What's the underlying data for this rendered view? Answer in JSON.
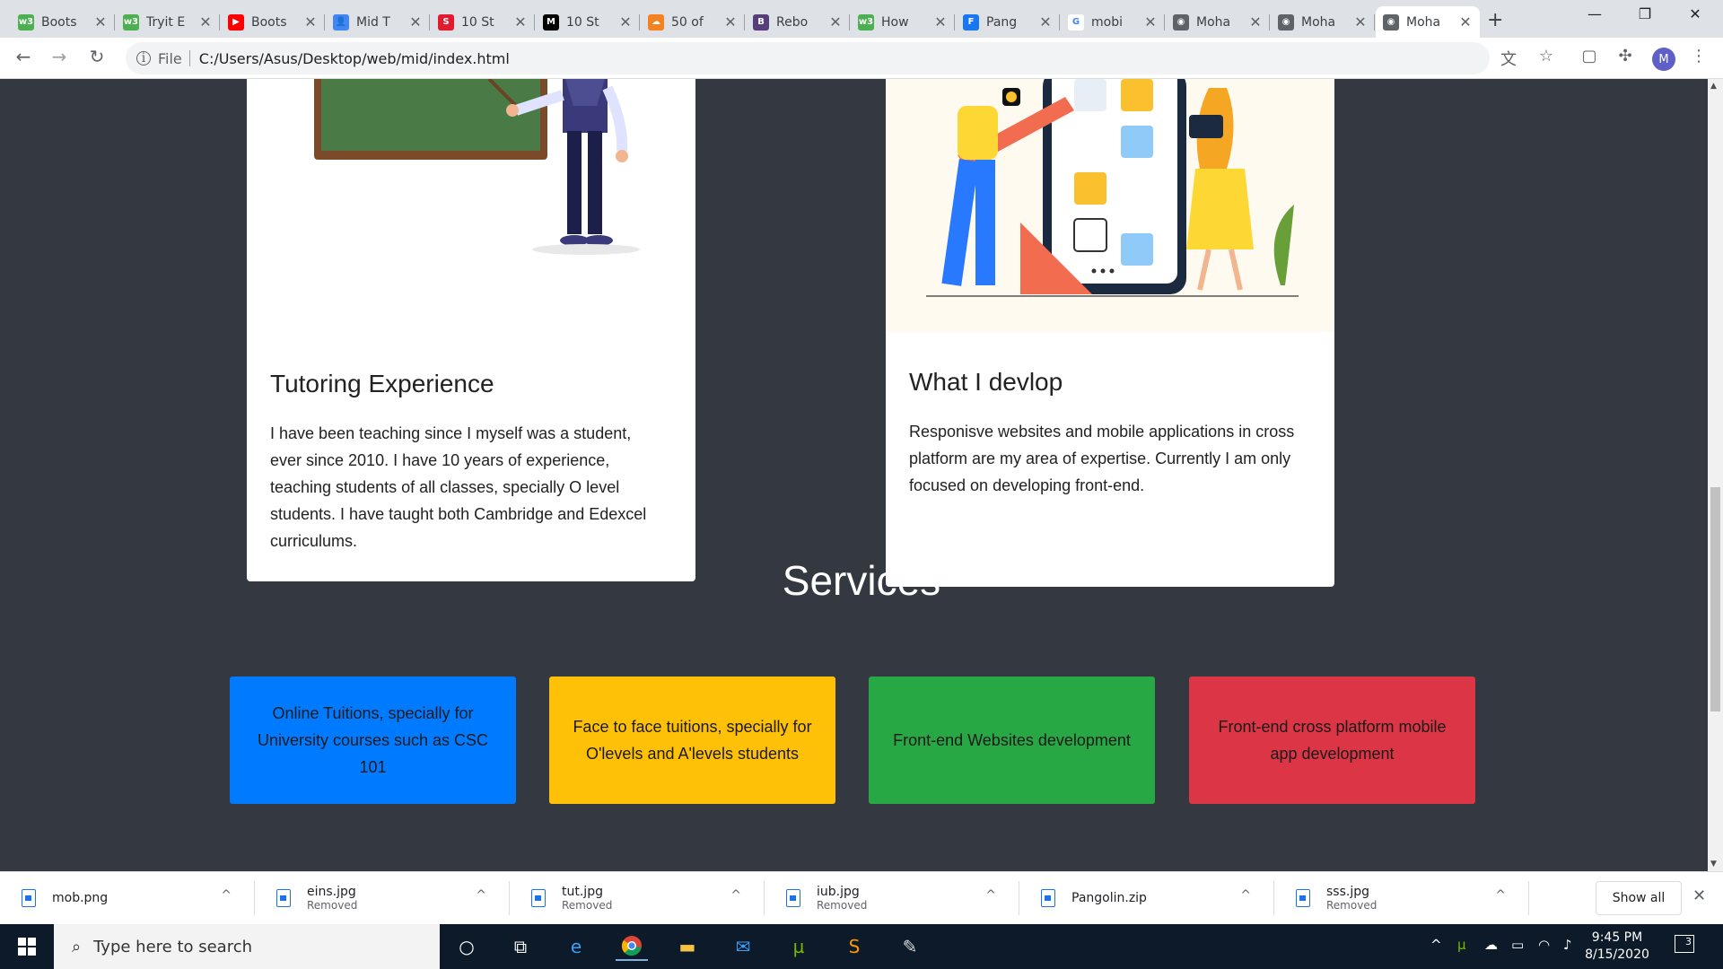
{
  "browser": {
    "tabs": [
      {
        "label": "Boots",
        "favicon": "w3schools-icon",
        "color": "#4caf50",
        "glyph": "w3"
      },
      {
        "label": "Tryit E",
        "favicon": "w3schools-icon",
        "color": "#4caf50",
        "glyph": "w3"
      },
      {
        "label": "Boots",
        "favicon": "youtube-icon",
        "color": "#ff0000",
        "glyph": "▶"
      },
      {
        "label": "Mid T",
        "favicon": "google-classroom-icon",
        "color": "#4285f4",
        "glyph": "👤"
      },
      {
        "label": "10 St",
        "favicon": "scribd-icon",
        "color": "#e21b2e",
        "glyph": "S"
      },
      {
        "label": "10 St",
        "favicon": "medium-icon",
        "color": "#000000",
        "glyph": "M"
      },
      {
        "label": "50 of",
        "favicon": "cloud-icon",
        "color": "#f58220",
        "glyph": "☁"
      },
      {
        "label": "Rebo",
        "favicon": "bootstrap-icon",
        "color": "#563d7c",
        "glyph": "B"
      },
      {
        "label": "How",
        "favicon": "w3schools-icon",
        "color": "#4caf50",
        "glyph": "w3"
      },
      {
        "label": "Pang",
        "favicon": "facebook-icon",
        "color": "#1877f2",
        "glyph": "F"
      },
      {
        "label": "mobi",
        "favicon": "google-icon",
        "color": "#ffffff",
        "glyph": "G"
      },
      {
        "label": "Moha",
        "favicon": "globe-icon",
        "color": "#5f6368",
        "glyph": "◉"
      },
      {
        "label": "Moha",
        "favicon": "globe-icon",
        "color": "#5f6368",
        "glyph": "◉"
      },
      {
        "label": "Moha",
        "favicon": "globe-icon",
        "color": "#5f6368",
        "glyph": "◉",
        "active": true
      }
    ],
    "address": {
      "file_label": "File",
      "url": "C:/Users/Asus/Desktop/web/mid/index.html"
    },
    "profile_initial": "M"
  },
  "page": {
    "tutoring": {
      "title": "Tutoring Experience",
      "text": "I have been teaching since I myself was a student, ever since 2010. I have 10 years of experience, teaching students of all classes, specially O level students. I have taught both Cambridge and Edexcel curriculums."
    },
    "develop": {
      "title": "What I devlop",
      "text": "Responisve websites and mobile applications in cross platform are my area of expertise. Currently I am only focused on developing front-end."
    },
    "services_heading": "Services",
    "services": [
      {
        "text": "Online Tuitions, specially for University courses such as CSC 101",
        "color": "#007bff"
      },
      {
        "text": "Face to face tuitions, specially for O'levels and A'levels students",
        "color": "#ffc107"
      },
      {
        "text": "Front-end Websites development",
        "color": "#28a745"
      },
      {
        "text": "Front-end cross platform mobile app development",
        "color": "#dc3545"
      }
    ]
  },
  "downloads": {
    "items": [
      {
        "name": "mob.png",
        "status": ""
      },
      {
        "name": "eins.jpg",
        "status": "Removed"
      },
      {
        "name": "tut.jpg",
        "status": "Removed"
      },
      {
        "name": "iub.jpg",
        "status": "Removed"
      },
      {
        "name": "Pangolin.zip",
        "status": ""
      },
      {
        "name": "sss.jpg",
        "status": "Removed"
      }
    ],
    "show_all": "Show all"
  },
  "taskbar": {
    "search_placeholder": "Type here to search",
    "time": "9:45 PM",
    "date": "8/15/2020",
    "notification_count": "3"
  }
}
